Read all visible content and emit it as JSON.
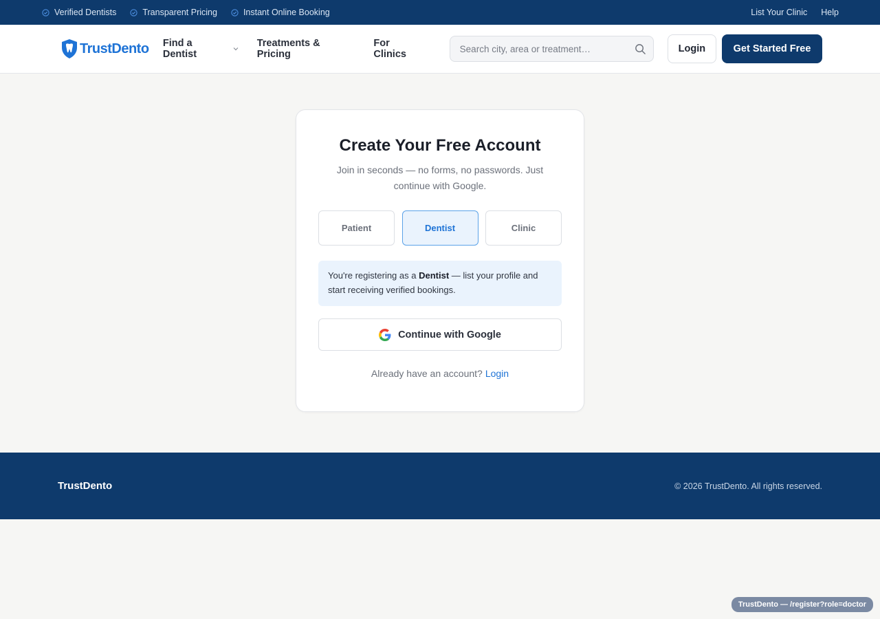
{
  "topbar": {
    "trust_items": [
      "Verified Dentists",
      "Transparent Pricing",
      "Instant Online Booking"
    ],
    "links": [
      "List Your Clinic",
      "Help"
    ]
  },
  "header": {
    "logo_text": "TrustDento",
    "nav": [
      "Find a Dentist",
      "Treatments & Pricing",
      "For Clinics"
    ],
    "search_placeholder": "Search city, area or treatment…",
    "login_label": "Login",
    "cta_label": "Get Started Free"
  },
  "card": {
    "title": "Create Your Free Account",
    "subtitle": "Join in seconds — no forms, no passwords. Just continue with Google.",
    "roles": [
      "Patient",
      "Dentist",
      "Clinic"
    ],
    "selected_role": "Dentist",
    "info_prefix": "You're registering as a ",
    "info_role": "Dentist",
    "info_suffix": " — list your profile and start receiving verified bookings.",
    "google_label": "Continue with Google",
    "signin_prompt": "Already have an account?",
    "signin_link": "Login"
  },
  "footer": {
    "brand": "TrustDento",
    "copyright": "© 2026 TrustDento. All rights reserved."
  },
  "route_badge": "TrustDento — /register?role=doctor",
  "colors": {
    "primary_navy": "#0e3a6c",
    "accent_blue": "#1e73d6",
    "selected_bg": "#eaf3fd"
  },
  "icons": {
    "trust": "check-circle-icon",
    "nav_dropdown": "chevron-down-icon",
    "search": "search-icon",
    "google": "google-icon",
    "logo": "tooth-shield-icon"
  }
}
